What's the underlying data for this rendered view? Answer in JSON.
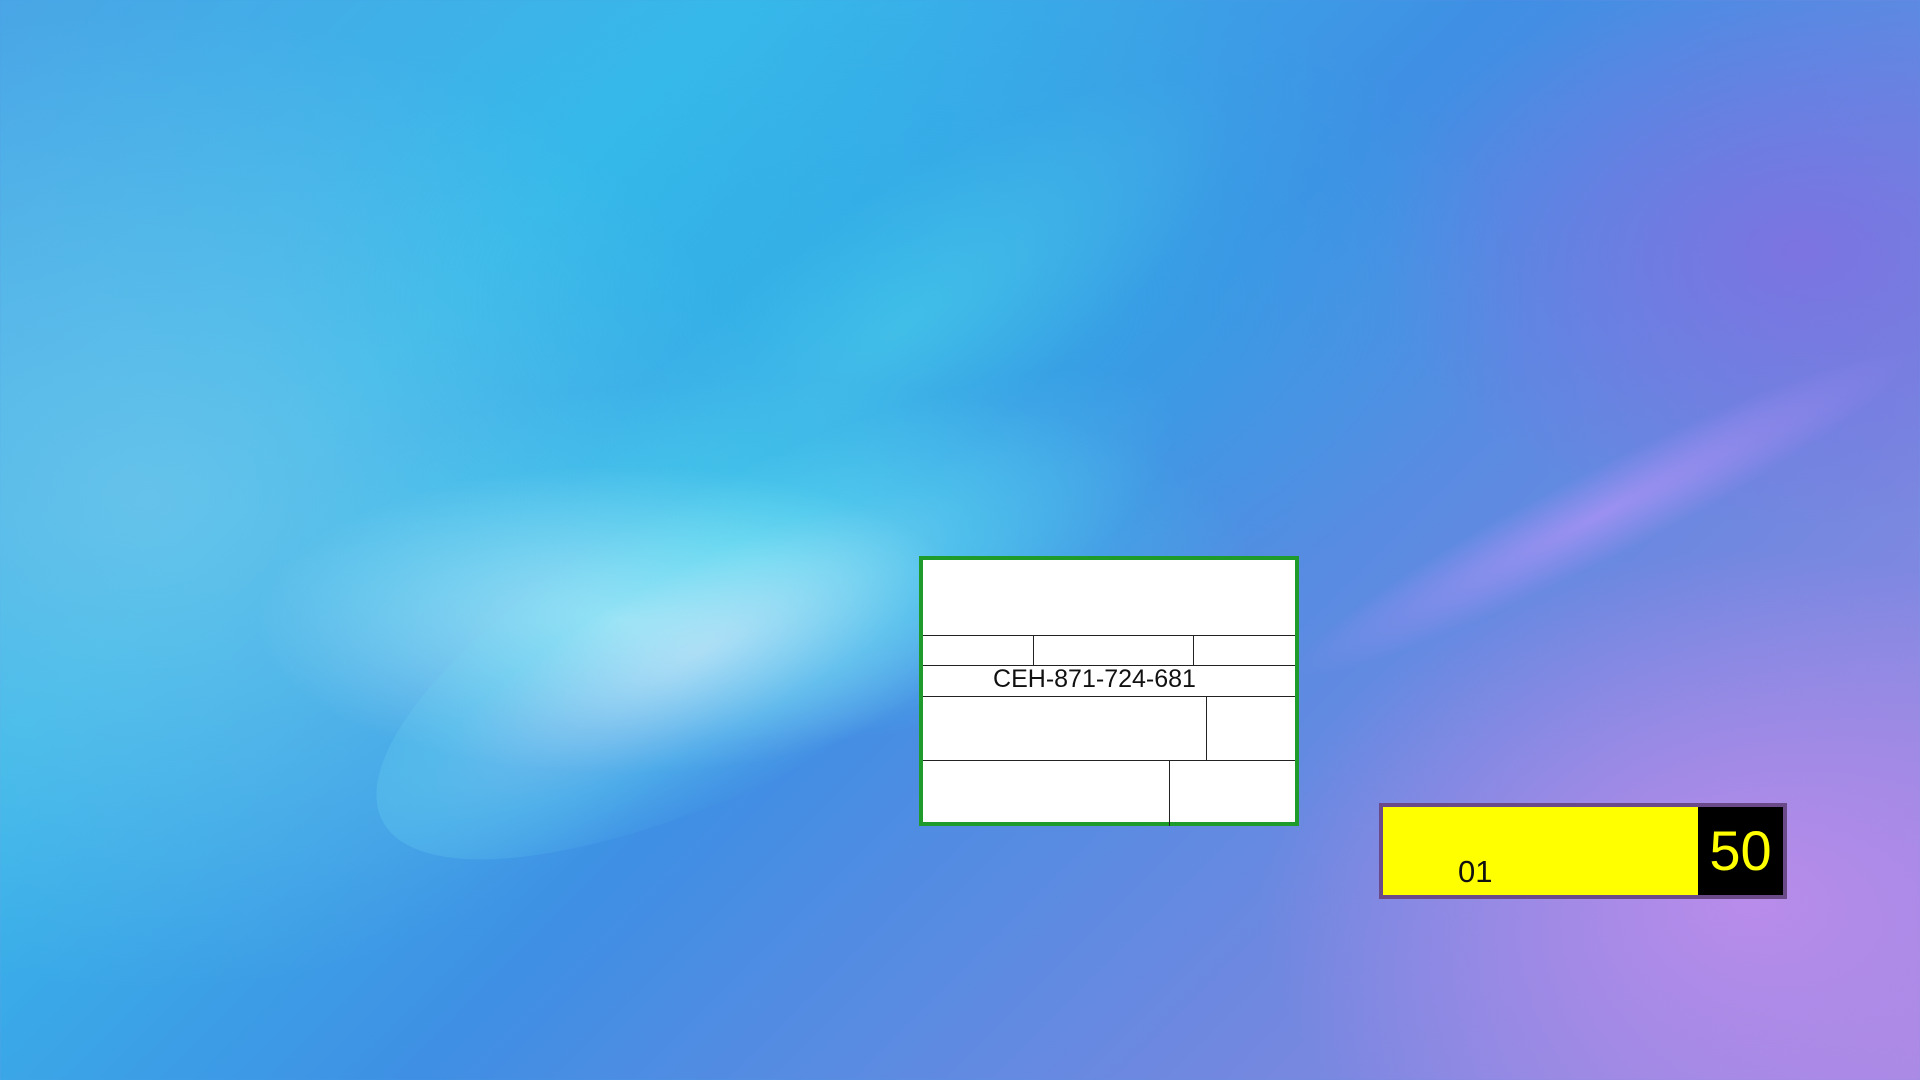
{
  "desktop": {
    "wallpaper_colors": [
      "#37b8ea",
      "#3f8fe4",
      "#a189e2"
    ]
  },
  "form": {
    "border_color": "#1e9b2a",
    "reference_code": "CEH-871-724-681"
  },
  "counter": {
    "left_value": "01",
    "right_value": "50",
    "left_color": "#ffff00",
    "right_color": "#000000",
    "border_color": "#6a4a88"
  }
}
